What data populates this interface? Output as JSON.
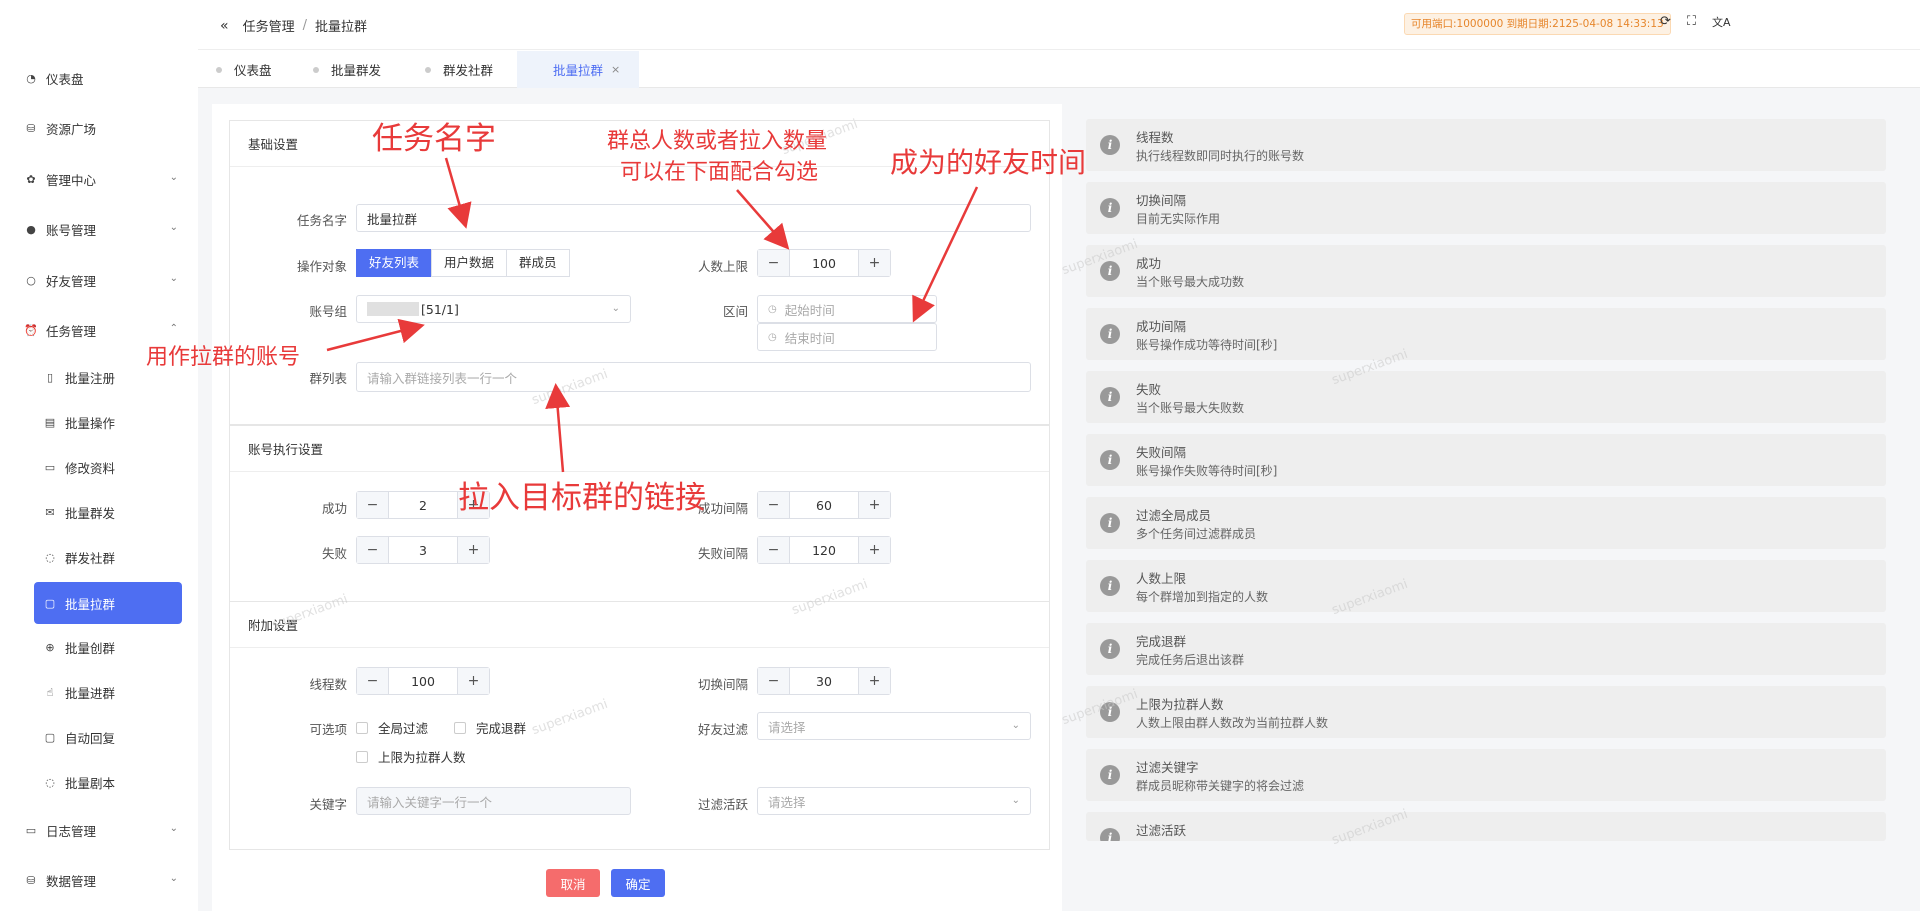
{
  "breadcrumb": {
    "collapse_icon": "double-chevron-left-icon",
    "parent": "任务管理",
    "sep": "/",
    "current": "批量拉群"
  },
  "license": "可用端口:1000000 到期日期:2125-04-08 14:33:13",
  "top_icons": [
    "refresh-icon",
    "fullscreen-icon",
    "translate-icon"
  ],
  "sidebar": {
    "items": [
      {
        "label": "仪表盘",
        "icon": "dashboard-icon"
      },
      {
        "label": "资源广场",
        "icon": "database-icon"
      },
      {
        "label": "管理中心",
        "icon": "gear-icon",
        "expandable": true
      },
      {
        "label": "账号管理",
        "icon": "user-icon",
        "expandable": true
      },
      {
        "label": "好友管理",
        "icon": "user-outline-icon",
        "expandable": true
      },
      {
        "label": "任务管理",
        "icon": "alarm-icon",
        "expandable": true,
        "expanded": true
      },
      {
        "label": "批量注册",
        "icon": "phone-icon"
      },
      {
        "label": "批量操作",
        "icon": "clipboard-icon"
      },
      {
        "label": "修改资料",
        "icon": "document-icon"
      },
      {
        "label": "批量群发",
        "icon": "mail-icon"
      },
      {
        "label": "群发社群",
        "icon": "chat-icon"
      },
      {
        "label": "批量拉群",
        "icon": "chat-square-icon"
      },
      {
        "label": "批量创群",
        "icon": "plus-circle-icon"
      },
      {
        "label": "批量进群",
        "icon": "pointer-icon"
      },
      {
        "label": "自动回复",
        "icon": "chat-square-icon"
      },
      {
        "label": "批量剧本",
        "icon": "chat-icon"
      },
      {
        "label": "日志管理",
        "icon": "message-icon",
        "expandable": true
      },
      {
        "label": "数据管理",
        "icon": "database-icon",
        "expandable": true
      }
    ]
  },
  "tabs": [
    {
      "label": "仪表盘"
    },
    {
      "label": "批量群发"
    },
    {
      "label": "群发社群"
    },
    {
      "label": "批量拉群",
      "active": true,
      "close": "×"
    }
  ],
  "basic": {
    "title": "基础设置",
    "task_name_label": "任务名字",
    "task_name_value": "批量拉群",
    "target_label": "操作对象",
    "target_options": [
      "好友列表",
      "用户数据",
      "群成员"
    ],
    "people_limit_label": "人数上限",
    "people_limit_value": "100",
    "account_group_label": "账号组",
    "account_group_value": "[51/1]",
    "interval_label": "区间",
    "start_placeholder": "起始时间",
    "end_placeholder": "结束时间",
    "group_list_label": "群列表",
    "group_list_placeholder": "请输入群链接列表一行一个"
  },
  "account_exec": {
    "title": "账号执行设置",
    "success_label": "成功",
    "success_value": "2",
    "success_interval_label": "成功间隔",
    "success_interval_value": "60",
    "fail_label": "失败",
    "fail_value": "3",
    "fail_interval_label": "失败间隔",
    "fail_interval_value": "120"
  },
  "extra": {
    "title": "附加设置",
    "threads_label": "线程数",
    "threads_value": "100",
    "switch_interval_label": "切换间隔",
    "switch_interval_value": "30",
    "options_label": "可选项",
    "opt_global_filter": "全局过滤",
    "opt_finish_quit": "完成退群",
    "opt_limit_as_pull": "上限为拉群人数",
    "friend_filter_label": "好友过滤",
    "friend_filter_placeholder": "请选择",
    "keyword_label": "关键字",
    "keyword_placeholder": "请输入关键字一行一个",
    "active_filter_label": "过滤活跃",
    "active_filter_placeholder": "请选择"
  },
  "buttons": {
    "cancel": "取消",
    "confirm": "确定",
    "cancel_color": "#f56c6c",
    "confirm_color": "#4e6ef2"
  },
  "help": [
    {
      "title": "线程数",
      "desc": "执行线程数即同时执行的账号数"
    },
    {
      "title": "切换间隔",
      "desc": "目前无实际作用"
    },
    {
      "title": "成功",
      "desc": "当个账号最大成功数"
    },
    {
      "title": "成功间隔",
      "desc": "账号操作成功等待时间[秒]"
    },
    {
      "title": "失败",
      "desc": "当个账号最大失败数"
    },
    {
      "title": "失败间隔",
      "desc": "账号操作失败等待时间[秒]"
    },
    {
      "title": "过滤全局成员",
      "desc": "多个任务间过滤群成员"
    },
    {
      "title": "人数上限",
      "desc": "每个群增加到指定的人数"
    },
    {
      "title": "完成退群",
      "desc": "完成任务后退出该群"
    },
    {
      "title": "上限为拉群人数",
      "desc": "人数上限由群人数改为当前拉群人数"
    },
    {
      "title": "过滤关键字",
      "desc": "群成员昵称带关键字的将会过滤"
    },
    {
      "title": "过滤活跃",
      "desc": ""
    }
  ],
  "annotations": {
    "task_name": "任务名字",
    "limit_line1": "群总人数或者拉入数量",
    "limit_line2": "可以在下面配合勾选",
    "friend_time": "成为的好友时间",
    "account": "用作拉群的账号",
    "group_link": "拉入目标群的链接"
  },
  "watermark": "superxiaomi",
  "accent": "#4e6ef2",
  "annotation_color": "#e83a3a"
}
